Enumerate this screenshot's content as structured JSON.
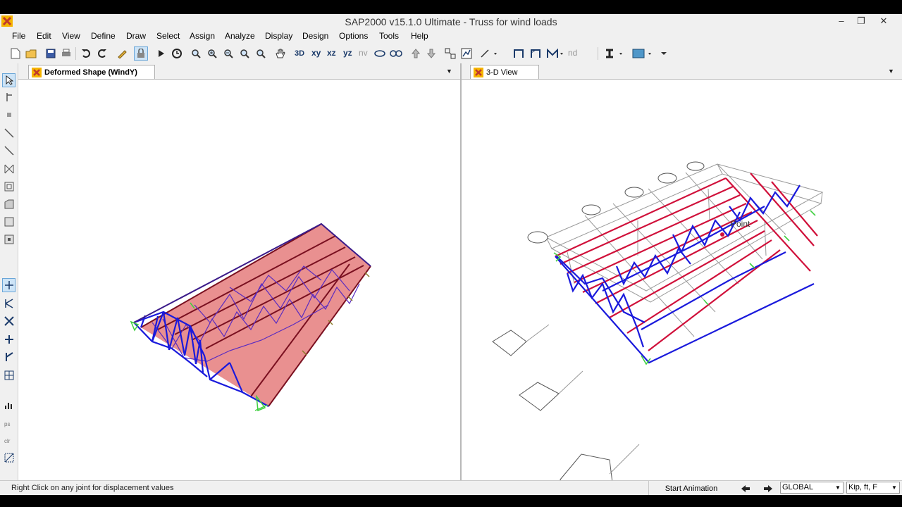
{
  "window": {
    "title": "SAP2000 v15.1.0 Ultimate  - Truss for wind loads",
    "controls": [
      "–",
      "❐",
      "✕"
    ]
  },
  "menu": [
    "File",
    "Edit",
    "View",
    "Define",
    "Draw",
    "Select",
    "Assign",
    "Analyze",
    "Display",
    "Design",
    "Options",
    "Tools",
    "Help"
  ],
  "toolbar": {
    "view_labels": {
      "xy": "xy",
      "xz": "xz",
      "yz": "yz",
      "nv": "nv"
    },
    "nd_label": "nd"
  },
  "panels": {
    "left": {
      "tab_title": "Deformed Shape (WindY)"
    },
    "right": {
      "tab_title": "3-D View",
      "point_label": "Point"
    }
  },
  "status": {
    "message": "Right Click on any joint for displacement values",
    "start_animation": "Start Animation",
    "coord_system": "GLOBAL",
    "units": "Kip, ft, F"
  },
  "colors": {
    "frame_blue": "#1a1adc",
    "frame_red": "#d0103a",
    "shell_fill": "#e88a8a",
    "support_green": "#3fcf3f"
  }
}
